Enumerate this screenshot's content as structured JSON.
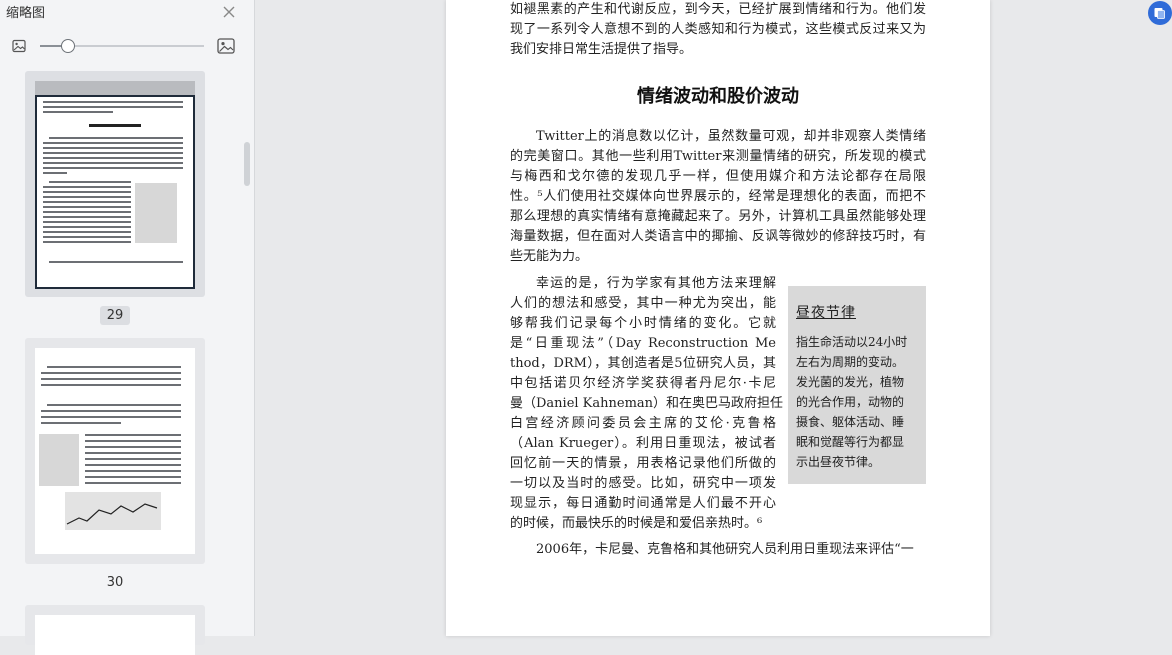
{
  "sidebar": {
    "title": "缩略图",
    "zoom_fraction": 0.17,
    "thumbnails": [
      {
        "page_label": "29",
        "selected": true
      },
      {
        "page_label": "30",
        "selected": false
      },
      {
        "page_label": "",
        "selected": false
      }
    ]
  },
  "icons": {
    "close": "close-icon",
    "image_small": "image-small-icon",
    "image_large": "image-large-icon",
    "app": "translate-app-icon"
  },
  "colors": {
    "accent": "#2f6bd8",
    "sidebar_bg": "#f3f4f6",
    "canvas_bg": "#e8e9eb",
    "sidebox_bg": "#d9d9d9"
  },
  "document": {
    "top_lines": [
      "如褪黑素的产生和代谢反应，到今天，已经扩展到情绪和行为。他们发",
      "现了一系列令人意想不到的人类感知和行为模式，这些模式反过来又为",
      "我们安排日常生活提供了指导。"
    ],
    "heading": "情绪波动和股价波动",
    "twitter_lines": [
      "Twitter上的消息数以亿计，虽然数量可观，却并非观察人类情绪",
      "的完美窗口。其他一些利用Twitter来测量情绪的研究，所发现的模式",
      "与梅西和戈尔德的发现几乎一样，但使用媒介和方法论都存在局限",
      "性。⁵人们使用社交媒体向世界展示的，经常是理想化的表面，而把不",
      "那么理想的真实情绪有意掩藏起来了。另外，计算机工具虽然能够处理",
      "海量数据，但在面对人类语言中的揶揄、反讽等微妙的修辞技巧时，有",
      "些无能为力。"
    ],
    "happy_lines": [
      "幸运的是，行为学家有其他方法来理解",
      "人们的想法和感受，其中一种尤为突出，能",
      "够帮我们记录每个小时情绪的变化。它就",
      "是“日重现法”（Day  Reconstruction  Me",
      "thod，DRM），其创造者是5位研究人员，其",
      "中包括诺贝尔经济学奖获得者丹尼尔·卡尼",
      "曼（Daniel Kahneman）和在奥巴马政府担任",
      "白宫经济顾问委员会主席的艾伦·克鲁格",
      "（Alan  Krueger）。利用日重现法，被试者",
      "回忆前一天的情景，用表格记录他们所做的",
      "一切以及当时的感受。比如，研究中一项发",
      "现显示，每日通勤时间通常是人们最不开心",
      "的时候，而最快乐的时候是和爱侣亲热时。⁶"
    ],
    "sidebox": {
      "title": "昼夜节律",
      "body_lines": [
        "指生命活动以24小时",
        "左右为周期的变动。",
        "发光菌的发光，植物",
        "的光合作用，动物的",
        "摄食、躯体活动、睡",
        "眠和觉醒等行为都显",
        "示出昼夜节律。"
      ]
    },
    "last_line": "2006年，卡尼曼、克鲁格和其他研究人员利用日重现法来评估“一"
  }
}
